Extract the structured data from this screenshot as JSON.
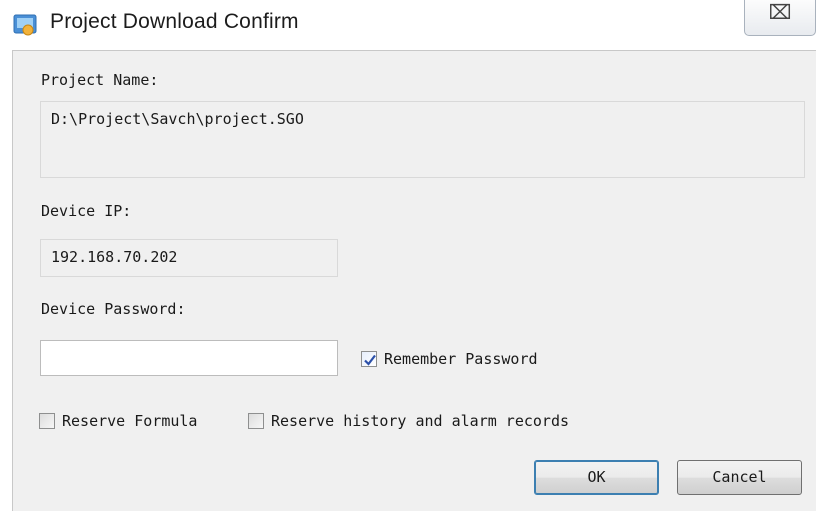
{
  "window": {
    "title": "Project Download Confirm",
    "close_glyph": "⌧",
    "icon": "app-icon"
  },
  "form": {
    "project_name_label": "Project Name:",
    "project_name_value": "D:\\Project\\Savch\\project.SGO",
    "device_ip_label": "Device IP:",
    "device_ip_value": "192.168.70.202",
    "device_password_label": "Device Password:",
    "device_password_value": "",
    "remember_password": {
      "label": "Remember Password",
      "checked": true
    },
    "reserve_formula": {
      "label": "Reserve Formula",
      "checked": false
    },
    "reserve_history": {
      "label": "Reserve history and alarm records",
      "checked": false
    }
  },
  "buttons": {
    "ok_label": "OK",
    "cancel_label": "Cancel"
  },
  "colors": {
    "dialog_bg": "#f0f0f0",
    "check_mark": "#2b4fa8"
  }
}
